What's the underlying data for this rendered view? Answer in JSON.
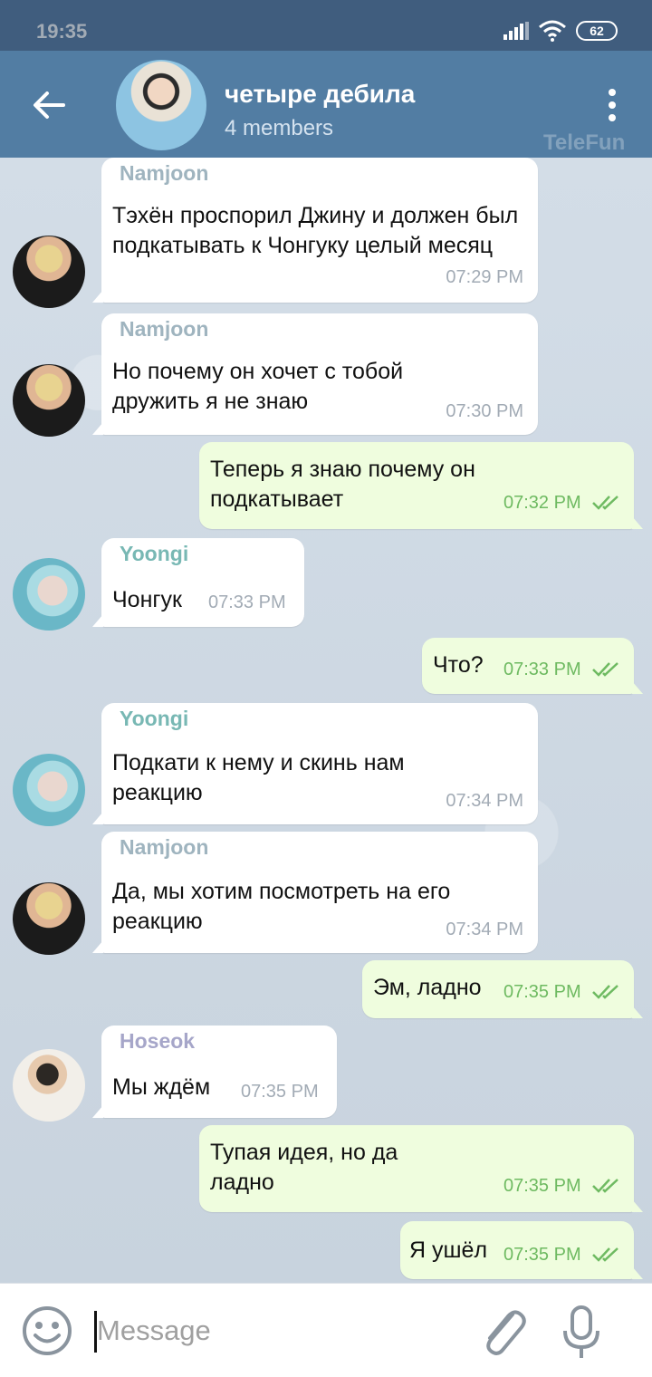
{
  "status": {
    "time": "19:35",
    "battery": "62"
  },
  "header": {
    "title": "четыре дебила",
    "subtitle": "4 members",
    "watermark": "TeleFun"
  },
  "messages": [
    {
      "sender": "Namjoon",
      "text": "Тэхён проспорил Джину и должен был подкатывать к Чонгуку целый месяц",
      "time": "07:29 PM"
    },
    {
      "sender": "Namjoon",
      "text": "Но почему он хочет с тобой дружить я не знаю",
      "time": "07:30 PM"
    },
    {
      "text": "Теперь я знаю почему он подкатывает",
      "time": "07:32 PM"
    },
    {
      "sender": "Yoongi",
      "text": "Чонгук",
      "time": "07:33 PM"
    },
    {
      "text": "Что?",
      "time": "07:33 PM"
    },
    {
      "sender": "Yoongi",
      "text": "Подкати к нему и скинь нам реакцию",
      "time": "07:34 PM"
    },
    {
      "sender": "Namjoon",
      "text": "Да, мы хотим посмотреть на его реакцию",
      "time": "07:34 PM"
    },
    {
      "text": "Эм, ладно",
      "time": "07:35 PM"
    },
    {
      "sender": "Hoseok",
      "text": "Мы ждём",
      "time": "07:35 PM"
    },
    {
      "text": "Тупая идея, но да ладно",
      "time": "07:35 PM"
    },
    {
      "text": "Я ушёл",
      "time": "07:35 PM"
    }
  ],
  "composer": {
    "placeholder": "Message"
  },
  "colors": {
    "header": "#527da3",
    "outgoing_bubble": "#effdde",
    "read_check": "#6eba61"
  }
}
